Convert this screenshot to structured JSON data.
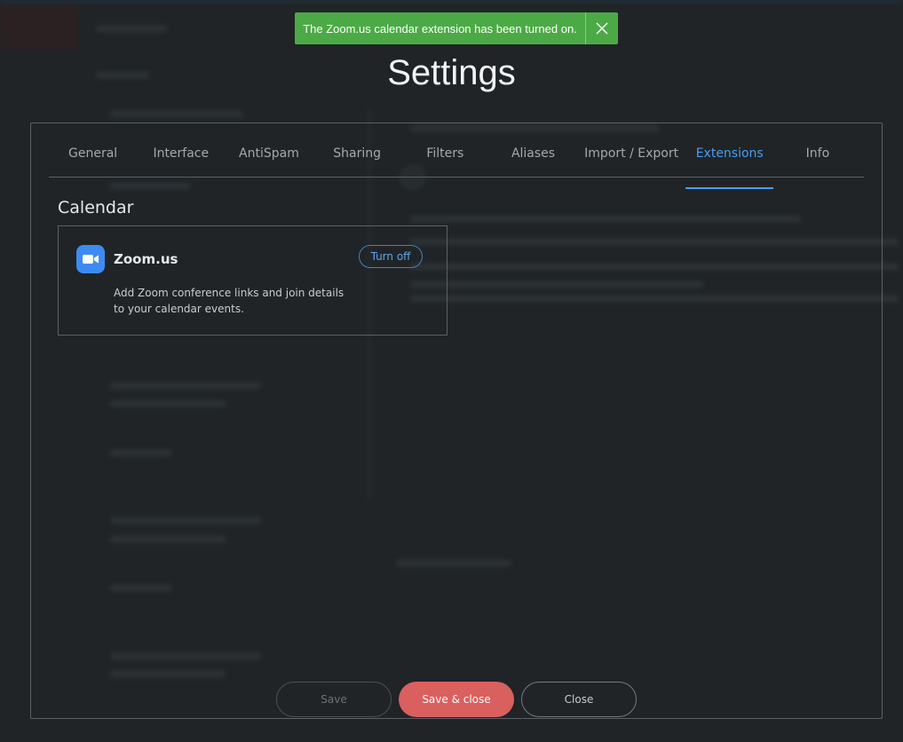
{
  "toast": {
    "message": "The Zoom.us calendar extension has been turned on.",
    "close_icon": "close-icon"
  },
  "dialog": {
    "title": "Settings",
    "tabs": [
      {
        "label": "General",
        "active": false
      },
      {
        "label": "Interface",
        "active": false
      },
      {
        "label": "AntiSpam",
        "active": false
      },
      {
        "label": "Sharing",
        "active": false
      },
      {
        "label": "Filters",
        "active": false
      },
      {
        "label": "Aliases",
        "active": false
      },
      {
        "label": "Import / Export",
        "active": false
      },
      {
        "label": "Extensions",
        "active": true
      },
      {
        "label": "Info",
        "active": false
      }
    ],
    "section_title": "Calendar",
    "extension": {
      "icon": "zoom-camera-icon",
      "name": "Zoom.us",
      "action_label": "Turn off",
      "description": "Add Zoom conference links and join details to your calendar events."
    },
    "footer": {
      "save_label": "Save",
      "save_close_label": "Save & close",
      "close_label": "Close"
    }
  },
  "colors": {
    "accent": "#4a9df0",
    "toast_bg": "#4caa46",
    "primary_button": "#d9605f",
    "zoom_blue": "#3d8bf2",
    "background": "#262a2d"
  }
}
